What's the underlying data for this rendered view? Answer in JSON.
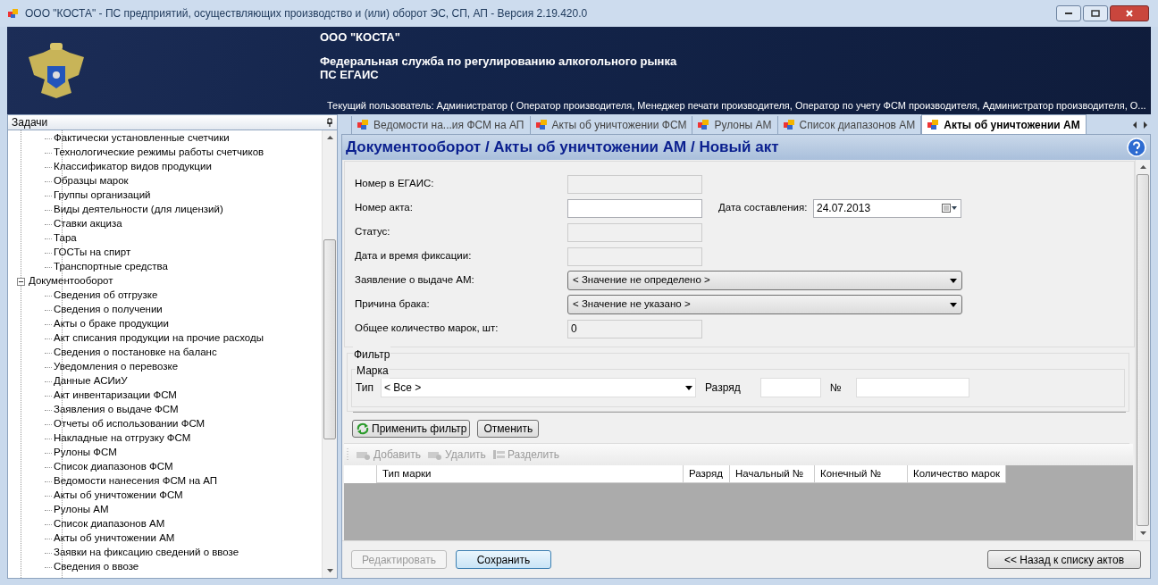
{
  "window": {
    "title": "ООО \"КОСТА\" - ПС предприятий, осуществляющих производство и (или) оборот ЭС, СП, АП - Версия 2.19.420.0"
  },
  "header": {
    "company": "ООО \"КОСТА\"",
    "agency": "Федеральная служба по регулированию алкогольного рынка",
    "system": "ПС ЕГАИС",
    "current_user": "Текущий пользователь: Администратор ( Оператор производителя, Менеджер печати производителя, Оператор по учету ФСМ производителя, Администратор производителя, О..."
  },
  "sidebar": {
    "title": "Задачи",
    "tree_partial": [
      "Фактически установленные счетчики",
      "Технологические режимы работы счетчиков",
      "Классификатор видов продукции",
      "Образцы марок",
      "Группы организаций",
      "Виды деятельности (для лицензий)",
      "Ставки акциза",
      "Тара",
      "ГОСТы на спирт",
      "Транспортные средства"
    ],
    "tree": [
      {
        "label": "Документооборот",
        "expanded": true,
        "children": [
          {
            "label": "Сведения об отгрузке"
          },
          {
            "label": "Сведения о получении"
          },
          {
            "label": "Акты о браке продукции"
          },
          {
            "label": "Акт списания продукции на прочие расходы"
          },
          {
            "label": "Сведения о постановке на баланс"
          },
          {
            "label": "Уведомления о перевозке"
          },
          {
            "label": "Данные АСИиУ"
          },
          {
            "label": "Акт инвентаризации ФСМ"
          },
          {
            "label": "Заявления о выдаче ФСМ"
          },
          {
            "label": "Отчеты об использовании ФСМ"
          },
          {
            "label": "Накладные на отгрузку ФСМ"
          },
          {
            "label": "Рулоны ФСМ"
          },
          {
            "label": "Список диапазонов ФСМ"
          },
          {
            "label": "Ведомости нанесения ФСМ на АП"
          },
          {
            "label": "Акты об уничтожении ФСМ"
          },
          {
            "label": "Рулоны АМ"
          },
          {
            "label": "Список диапазонов АМ"
          },
          {
            "label": "Акты об уничтожении АМ"
          },
          {
            "label": "Заявки на фиксацию сведений о ввозе"
          },
          {
            "label": "Сведения о ввозе"
          }
        ]
      }
    ]
  },
  "tabs": [
    {
      "label": "Ведомости на...ия ФСМ на АП",
      "selected": false
    },
    {
      "label": "Акты об уничтожении ФСМ",
      "selected": false
    },
    {
      "label": "Рулоны АМ",
      "selected": false
    },
    {
      "label": "Список диапазонов АМ",
      "selected": false
    },
    {
      "label": "Акты об уничтожении АМ",
      "selected": true
    }
  ],
  "page_title": "Документооборот / Акты об уничтожении АМ / Новый акт",
  "form": [
    {
      "kind": "text",
      "label": "Номер в ЕГАИС:",
      "disabled": true
    },
    {
      "kind": "text",
      "label": "Номер акта:",
      "disabled": false,
      "extra_label": "Дата составления:",
      "extra_value": "24.07.2013"
    },
    {
      "kind": "text",
      "label": "Статус:",
      "disabled": true
    },
    {
      "kind": "text",
      "label": "Дата и время фиксации:",
      "disabled": true
    },
    {
      "kind": "combo",
      "label": "Заявление о выдаче АМ:",
      "value": "< Значение не определено >"
    },
    {
      "kind": "combo",
      "label": "Причина брака:",
      "value": "< Значение не указано >"
    },
    {
      "kind": "text",
      "label": "Общее количество марок, шт:",
      "disabled": true,
      "value": "0"
    }
  ],
  "filter": {
    "title": "Фильтр",
    "group": "Марка",
    "type_label": "Тип",
    "type_value": "< Все >",
    "rank_label": "Разряд",
    "number_label": "№",
    "apply": "Применить фильтр",
    "cancel": "Отменить"
  },
  "toolbar": [
    {
      "label": "Добавить",
      "disabled": true
    },
    {
      "label": "Удалить",
      "disabled": true
    },
    {
      "label": "Разделить",
      "disabled": true
    }
  ],
  "table": {
    "columns": [
      "Тип марки",
      "Разряд",
      "Начальный №",
      "Конечный №",
      "Количество марок"
    ]
  },
  "footer": [
    {
      "label": "Редактировать",
      "disabled": true
    },
    {
      "label": "Сохранить",
      "disabled": false
    }
  ],
  "back_button": "<< Назад к списку актов"
}
